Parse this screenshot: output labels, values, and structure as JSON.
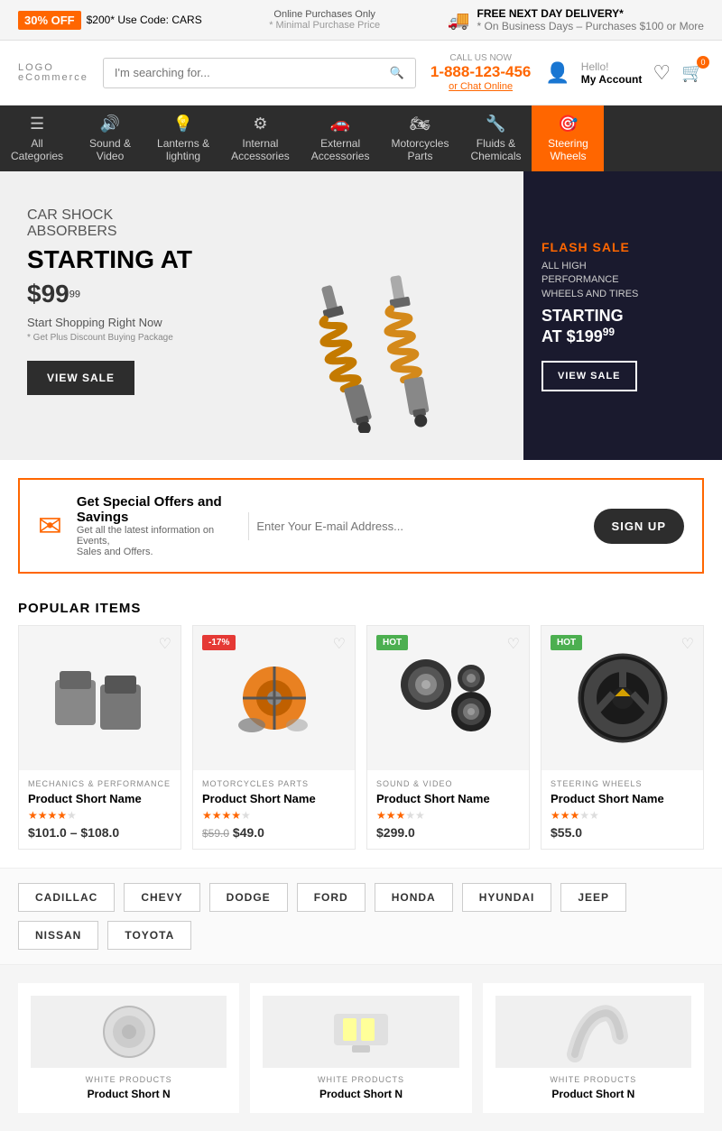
{
  "topBanner": {
    "badge": "30% OFF",
    "promo": "$200* Use Code: CARS",
    "online": "Online Purchases Only",
    "note": "* Minimal Purchase Price",
    "delivery": "FREE NEXT DAY DELIVERY*",
    "deliveryNote": "* On Business Days – Purchases $100 or More"
  },
  "header": {
    "logo": "LOGO",
    "logoSub": "eCommerce",
    "searchPlaceholder": "I'm searching for...",
    "callLabel": "CALL US NOW",
    "phone": "1-888-123-456",
    "chatLink": "or Chat Online",
    "accountLabel": "Hello!",
    "accountSub": "My Account",
    "cartCount": "0"
  },
  "nav": {
    "items": [
      {
        "id": "all",
        "icon": "☰",
        "label": "All\nCategories"
      },
      {
        "id": "sound",
        "icon": "🔊",
        "label": "Sound &\nVideo"
      },
      {
        "id": "lanterns",
        "icon": "💡",
        "label": "Lanterns &\nlighting"
      },
      {
        "id": "internal",
        "icon": "⚙",
        "label": "Internal\nAccessories"
      },
      {
        "id": "external",
        "icon": "🚗",
        "label": "External\nAccessories"
      },
      {
        "id": "motorcycles",
        "icon": "🏍",
        "label": "Motorcycles\nParts"
      },
      {
        "id": "fluids",
        "icon": "🔧",
        "label": "Fluids &\nChemicals"
      },
      {
        "id": "steering",
        "icon": "🎯",
        "label": "Steering\nWheels",
        "active": true
      }
    ]
  },
  "hero": {
    "subtitle": "CAR SHOCK\nABSORBERS",
    "startingAt": "STARTING AT",
    "price": "$99",
    "priceCents": "99",
    "desc": "Start Shopping Right Now",
    "note": "* Get Plus Discount Buying Package",
    "btnLabel": "VIEW SALE",
    "flash": {
      "label": "FLASH SALE",
      "desc": "ALL HIGH\nPERFORMANCE\nWHEELS AND TIRES",
      "startingAt": "STARTING\nAT",
      "price": "$199",
      "priceCents": "99",
      "btnLabel": "VIEW SALE"
    }
  },
  "newsletter": {
    "title": "Get Special Offers and Savings",
    "subtitle": "Get all the latest information on Events,\nSales and Offers.",
    "placeholder": "Enter Your E-mail Address...",
    "btnLabel": "SIGN UP"
  },
  "popular": {
    "title": "POPULAR ITEMS",
    "products": [
      {
        "badge": "",
        "badgeType": "",
        "category": "MECHANICS & PERFORMANCE",
        "name": "Product Short Name",
        "stars": 4,
        "maxStars": 5,
        "price": "$101.0 – $108.0",
        "oldPrice": "",
        "color": "gray"
      },
      {
        "badge": "-17%",
        "badgeType": "sale",
        "category": "MOTORCYCLES PARTS",
        "name": "Product Short Name",
        "stars": 4,
        "maxStars": 5,
        "price": "$49.0",
        "oldPrice": "$59.0",
        "color": "orange"
      },
      {
        "badge": "HOT",
        "badgeType": "hot",
        "category": "SOUND & VIDEO",
        "name": "Product Short Name",
        "stars": 3,
        "maxStars": 5,
        "price": "$299.0",
        "oldPrice": "",
        "color": "dark"
      },
      {
        "badge": "HOT",
        "badgeType": "hot",
        "category": "STEERING WHEELS",
        "name": "Product Short Name",
        "stars": 3,
        "maxStars": 5,
        "price": "$55.0",
        "oldPrice": "",
        "color": "steering"
      }
    ]
  },
  "brands": {
    "items": [
      "CADILLAC",
      "CHEVY",
      "DODGE",
      "FORD",
      "HONDA",
      "HYUNDAI",
      "JEEP",
      "NISSAN",
      "TOYOTA"
    ]
  },
  "bottomProducts": [
    {
      "label": "WHITE PRODUCTS",
      "name": "Product Short N"
    },
    {
      "label": "WHITE PRODUCTS",
      "name": "Product Short N"
    },
    {
      "label": "WHITE PRODUCTS",
      "name": "Product Short N"
    }
  ]
}
